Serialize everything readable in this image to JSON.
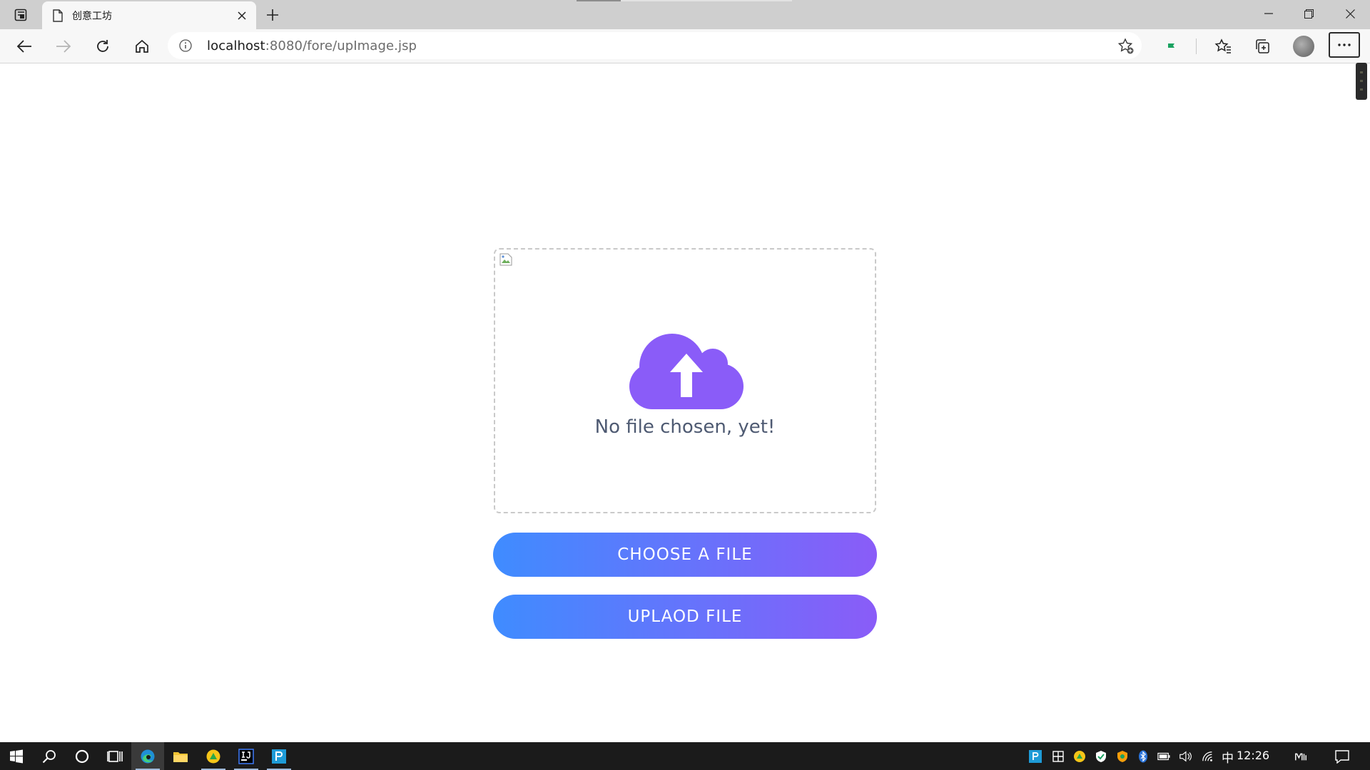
{
  "browser": {
    "tab": {
      "title": "创意工坊",
      "icon": "page-icon"
    },
    "address": {
      "host": "localhost",
      "path": ":8080/fore/upImage.jsp"
    },
    "colors": {
      "tab_strip": "#cfcfcf",
      "toolbar": "#f7f7f7",
      "extension_green": "#1aa260"
    }
  },
  "upload": {
    "status_text": "No file chosen, yet!",
    "choose_label": "CHOOSE A FILE",
    "upload_label": "UPLAOD FILE",
    "icon": "cloud-upload-icon",
    "colors": {
      "cloud": "#8a5cf8",
      "gradient_start": "#3f8cff",
      "gradient_end": "#8a5cf8",
      "status_text": "#4e5a72"
    }
  },
  "taskbar": {
    "clock": "12:26",
    "ime": "中",
    "pinned": [
      "start-icon",
      "search-icon",
      "cortana-icon",
      "task-view-icon",
      "edge-icon",
      "file-explorer-icon",
      "app-icon",
      "intellij-icon",
      "pycharm-icon"
    ],
    "tray": [
      "pycharm-tray-icon",
      "app-tray-icon",
      "app-tray-icon",
      "security-icon",
      "app-tray-icon",
      "bluetooth-icon",
      "battery-icon",
      "volume-icon",
      "network-icon"
    ]
  }
}
